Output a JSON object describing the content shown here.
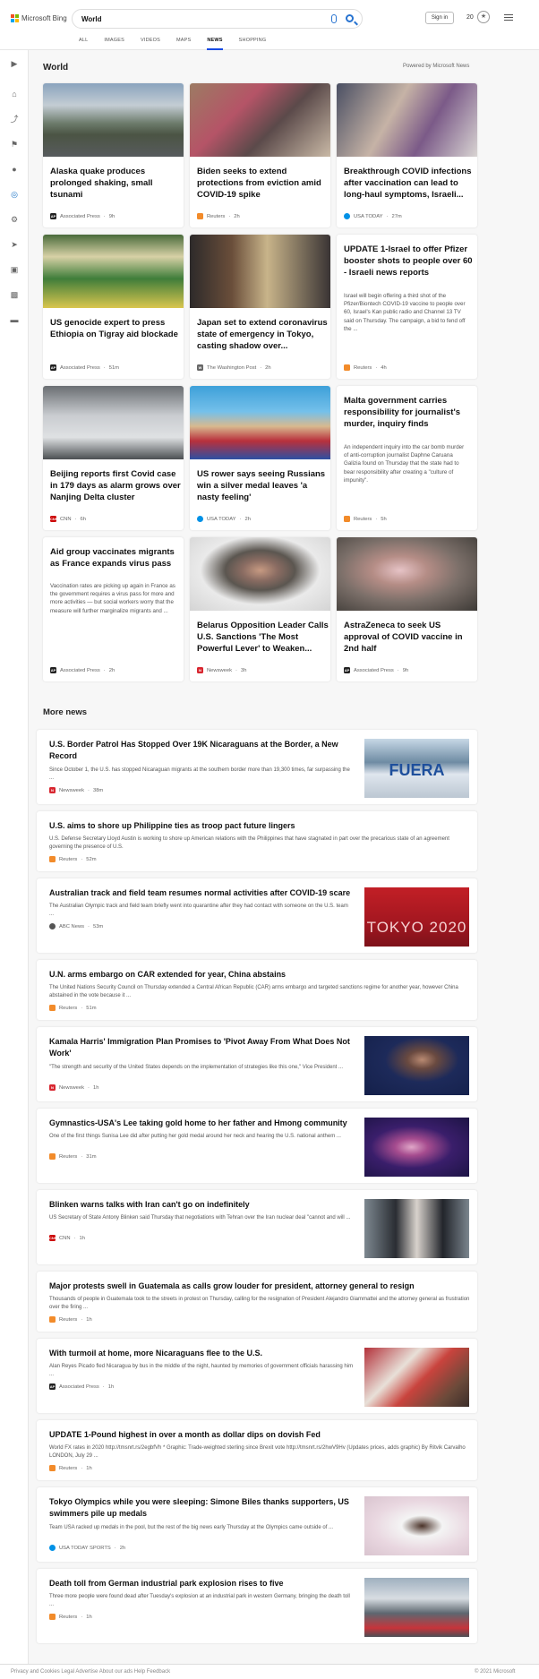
{
  "header": {
    "brand": "Microsoft Bing",
    "query": "World",
    "signin": "Sign in",
    "points": "20",
    "tabs": [
      {
        "label": "ALL"
      },
      {
        "label": "IMAGES"
      },
      {
        "label": "VIDEOS"
      },
      {
        "label": "MAPS"
      },
      {
        "label": "NEWS"
      },
      {
        "label": "SHOPPING"
      }
    ]
  },
  "sidebar": {
    "icons": [
      "expand-icon",
      "home-icon",
      "shuffle-icon",
      "flag-icon",
      "location-pin-icon",
      "globe-icon",
      "microscope-icon",
      "rocket-icon",
      "film-icon",
      "briefcase-icon",
      "card-icon"
    ]
  },
  "section": {
    "title": "World",
    "powered": "Powered by Microsoft News",
    "more": "More news"
  },
  "cards": [
    {
      "title": "Alaska quake produces prolonged shaking, small tsunami",
      "source": "Associated Press",
      "time": "9h",
      "snippet": ""
    },
    {
      "title": "Biden seeks to extend protections from eviction amid COVID-19 spike",
      "source": "Reuters",
      "time": "2h",
      "snippet": ""
    },
    {
      "title": "Breakthrough COVID infections after vaccination can lead to long-haul symptoms, Israeli...",
      "source": "USA TODAY",
      "time": "27m",
      "snippet": ""
    },
    {
      "title": "US genocide expert to press Ethiopia on Tigray aid blockade",
      "source": "Associated Press",
      "time": "51m",
      "snippet": ""
    },
    {
      "title": "Japan set to extend coronavirus state of emergency in Tokyo, casting shadow over...",
      "source": "The Washington Post",
      "time": "2h",
      "snippet": ""
    },
    {
      "title": "UPDATE 1-Israel to offer Pfizer booster shots to people over 60 - Israeli news reports",
      "source": "Reuters",
      "time": "4h",
      "snippet": "Israel will begin offering a third shot of the Pfizer/Biontech COVID-19 vaccine to people over 60, Israel's Kan public radio and Channel 13 TV said on Thursday. The campaign, a bid to fend off the ..."
    },
    {
      "title": "Beijing reports first Covid case in 179 days as alarm grows over Nanjing Delta cluster",
      "source": "CNN",
      "time": "6h",
      "snippet": ""
    },
    {
      "title": "US rower says seeing Russians win a silver medal leaves 'a nasty feeling'",
      "source": "USA TODAY",
      "time": "2h",
      "snippet": ""
    },
    {
      "title": "Malta government carries responsibility for journalist's murder, inquiry finds",
      "source": "Reuters",
      "time": "5h",
      "snippet": "An independent inquiry into the car bomb murder of anti-corruption journalist Daphne Caruana Galizia found on Thursday that the state had to bear responsibility after creating a \"culture of impunity\"."
    },
    {
      "title": "Aid group vaccinates migrants as France expands virus pass",
      "source": "Associated Press",
      "time": "2h",
      "snippet": "Vaccination rates are picking up again in France as the government requires a virus pass for more and more activities — but social workers worry that the measure will further marginalize migrants and ..."
    },
    {
      "title": "Belarus Opposition Leader Calls U.S. Sanctions 'The Most Powerful Lever' to Weaken...",
      "source": "Newsweek",
      "time": "3h",
      "snippet": ""
    },
    {
      "title": "AstraZeneca to seek US approval of COVID vaccine in 2nd half",
      "source": "Associated Press",
      "time": "9h",
      "snippet": ""
    }
  ],
  "more": [
    {
      "title": "U.S. Border Patrol Has Stopped Over 19K Nicaraguans at the Border, a New Record",
      "snippet": "Since October 1, the U.S. has stopped Nicaraguan migrants at the southern border more than 19,300 times, far surpassing the ...",
      "source": "Newsweek",
      "time": "38m",
      "thumb_text": "FUERA"
    },
    {
      "title": "U.S. aims to shore up Philippine ties as troop pact future lingers",
      "snippet": "U.S. Defense Secretary Lloyd Austin is working to shore up American relations with the Philippines that have stagnated in part over the precarious state of an agreement governing the presence of U.S.",
      "source": "Reuters",
      "time": "52m"
    },
    {
      "title": "Australian track and field team resumes normal activities after COVID-19 scare",
      "snippet": "The Australian Olympic track and field team briefly went into quarantine after they had contact with someone on the U.S. team ...",
      "source": "ABC News",
      "time": "53m",
      "thumb_text": "TOKYO 2020"
    },
    {
      "title": "U.N. arms embargo on CAR extended for year, China abstains",
      "snippet": "The United Nations Security Council on Thursday extended a Central African Republic (CAR) arms embargo and targeted sanctions regime for another year, however China abstained in the vote because it ...",
      "source": "Reuters",
      "time": "51m"
    },
    {
      "title": "Kamala Harris' Immigration Plan Promises to 'Pivot Away From What Does Not Work'",
      "snippet": "\"The strength and security of the United States depends on the implementation of strategies like this one,\" Vice President ...",
      "source": "Newsweek",
      "time": "1h"
    },
    {
      "title": "Gymnastics-USA's Lee taking gold home to her father and Hmong community",
      "snippet": "One of the first things Sunisa Lee did after putting her gold medal around her neck and hearing the U.S. national anthem ...",
      "source": "Reuters",
      "time": "31m"
    },
    {
      "title": "Blinken warns talks with Iran can't go on indefinitely",
      "snippet": "US Secretary of State Antony Blinken said Thursday that negotiations with Tehran over the Iran nuclear deal \"cannot and will ...",
      "source": "CNN",
      "time": "1h"
    },
    {
      "title": "Major protests swell in Guatemala as calls grow louder for president, attorney general to resign",
      "snippet": "Thousands of people in Guatemala took to the streets in protest on Thursday, calling for the resignation of President Alejandro Giammattei and the attorney general as frustration over the firing ...",
      "source": "Reuters",
      "time": "1h"
    },
    {
      "title": "With turmoil at home, more Nicaraguans flee to the U.S.",
      "snippet": "Alan Reyes Picado fled Nicaragua by bus in the middle of the night, haunted by memories of government officials harassing him ...",
      "source": "Associated Press",
      "time": "1h"
    },
    {
      "title": "UPDATE 1-Pound highest in over a month as dollar dips on dovish Fed",
      "snippet": "World FX rates in 2020 http://tmsnrt.rs/2egbfVh * Graphic: Trade-weighted sterling since Brexit vote http://tmsnrt.rs/2hwV9Hv (Updates prices, adds graphic) By Ritvik Carvalho LONDON, July 29 ...",
      "source": "Reuters",
      "time": "1h"
    },
    {
      "title": "Tokyo Olympics while you were sleeping: Simone Biles thanks supporters, US swimmers pile up medals",
      "snippet": "Team USA racked up medals in the pool, but the rest of the big news early Thursday at the Olympics came outside of ...",
      "source": "USA TODAY SPORTS",
      "time": "2h"
    },
    {
      "title": "Death toll from German industrial park explosion rises to five",
      "snippet": "Three more people were found dead after Tuesday's explosion at an industrial park in western Germany, bringing the death toll ...",
      "source": "Reuters",
      "time": "1h"
    }
  ],
  "footer": {
    "left": "Privacy and Cookies   Legal   Advertise   About our ads   Help   Feedback",
    "right": "© 2021 Microsoft"
  }
}
